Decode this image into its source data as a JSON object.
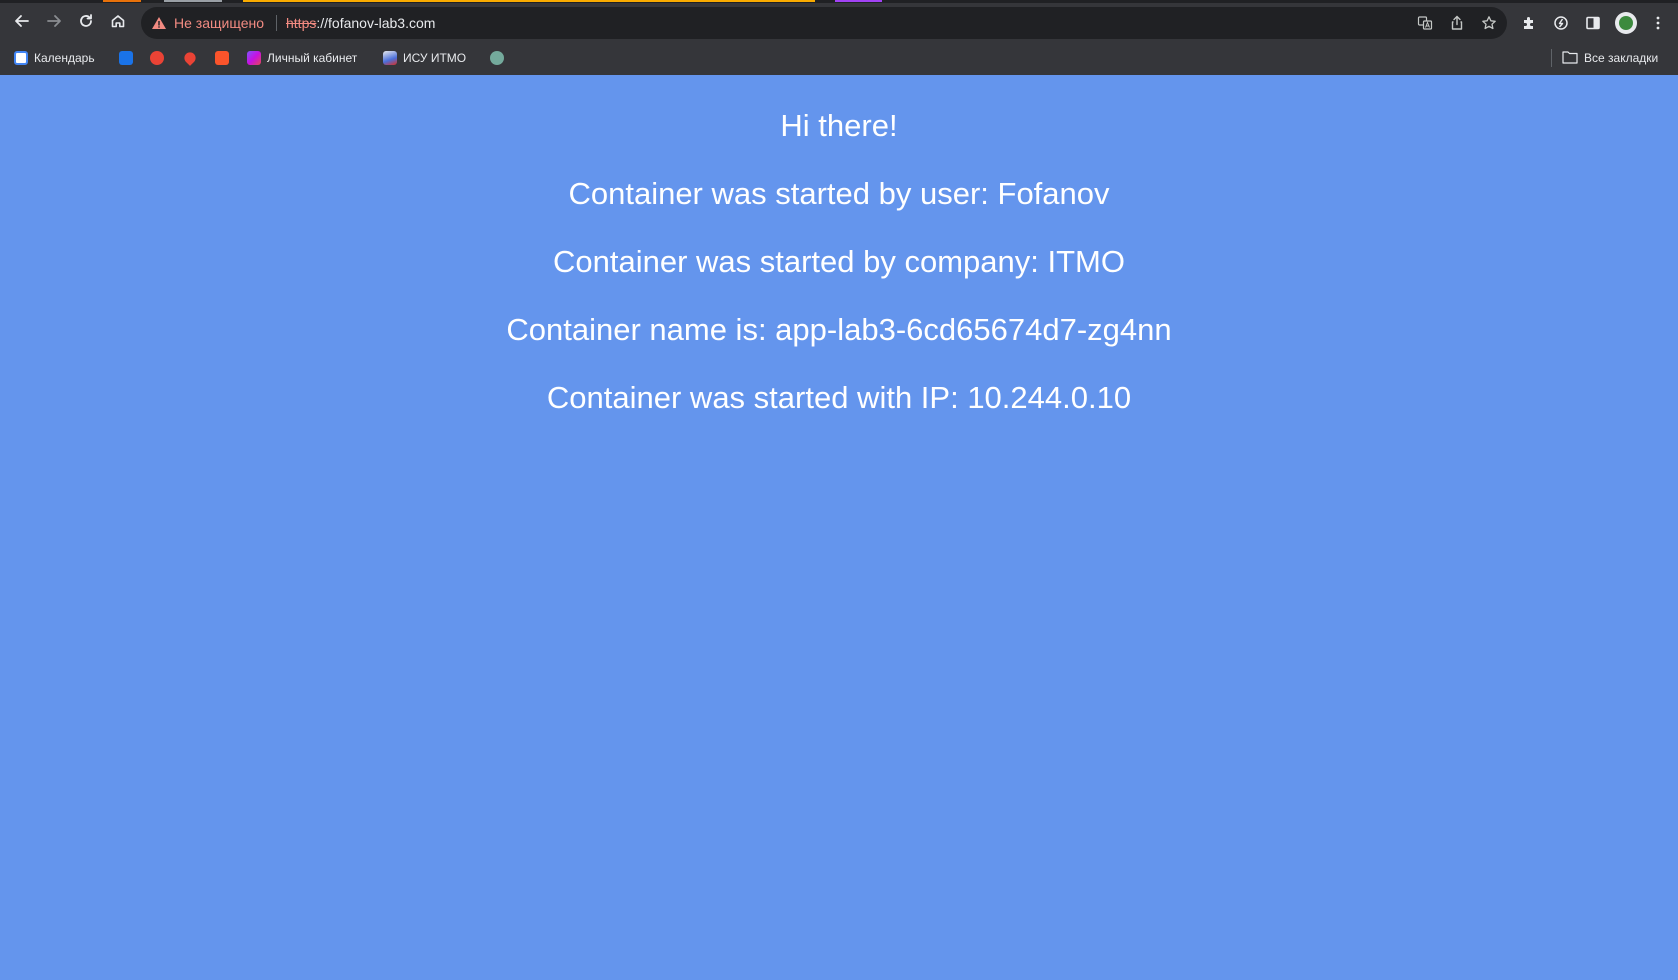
{
  "browser": {
    "security_label": "Не защищено",
    "url_scheme": "https",
    "url_rest": "://fofanov-lab3.com",
    "icons": {
      "back": "back-arrow-icon",
      "forward": "forward-arrow-icon",
      "reload": "reload-icon",
      "home": "home-icon",
      "warning": "warning-triangle-icon",
      "translate": "translate-icon",
      "share": "share-icon",
      "bookmark_star": "star-icon",
      "extensions": "puzzle-icon",
      "performance": "speedometer-icon",
      "side_panel": "side-panel-icon",
      "menu": "kebab-menu-icon"
    }
  },
  "bookmarks": {
    "items": [
      {
        "label": "Календарь",
        "icon": "calendar-favicon"
      },
      {
        "label": "",
        "icon": "chat-favicon"
      },
      {
        "label": "",
        "icon": "app-favicon"
      },
      {
        "label": "",
        "icon": "maps-pin-favicon"
      },
      {
        "label": "",
        "icon": "brave-favicon"
      },
      {
        "label": "Личный кабинет",
        "icon": "kotlin-favicon"
      },
      {
        "label": "ИСУ ИТМО",
        "icon": "itmo-favicon"
      },
      {
        "label": "",
        "icon": "openai-favicon"
      }
    ],
    "all_bookmarks": "Все закладки"
  },
  "page": {
    "greeting": "Hi there!",
    "user_line": "Container was started by user: Fofanov",
    "company_line": "Container was started by company: ITMO",
    "name_line": "Container name is: app-lab3-6cd65674d7-zg4nn",
    "ip_line": "Container was started with IP: 10.244.0.10"
  },
  "colors": {
    "page_background": "#6495ed",
    "chrome_background": "#35363a",
    "omnibox_background": "#202124",
    "warning": "#f28b82"
  }
}
